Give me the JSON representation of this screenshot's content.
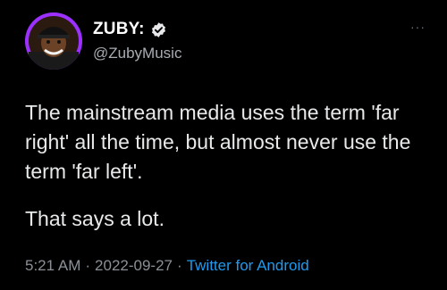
{
  "author": {
    "display_name": "ZUBY:",
    "handle": "@ZubyMusic",
    "verified": true,
    "avatar_icon": "profile-avatar",
    "avatar_ring_color": "#9b30ff"
  },
  "more_menu": "···",
  "tweet": {
    "text": "The mainstream media uses the term 'far right' all the time, but almost never use the term 'far left'.",
    "text2": "That says a lot."
  },
  "meta": {
    "time": "5:21 AM",
    "separator": "·",
    "date": "2022-09-27",
    "source": "Twitter for Android"
  },
  "colors": {
    "background": "#000000",
    "text": "#e7e9ea",
    "secondary": "#8b9096",
    "link": "#1d9bf0"
  }
}
